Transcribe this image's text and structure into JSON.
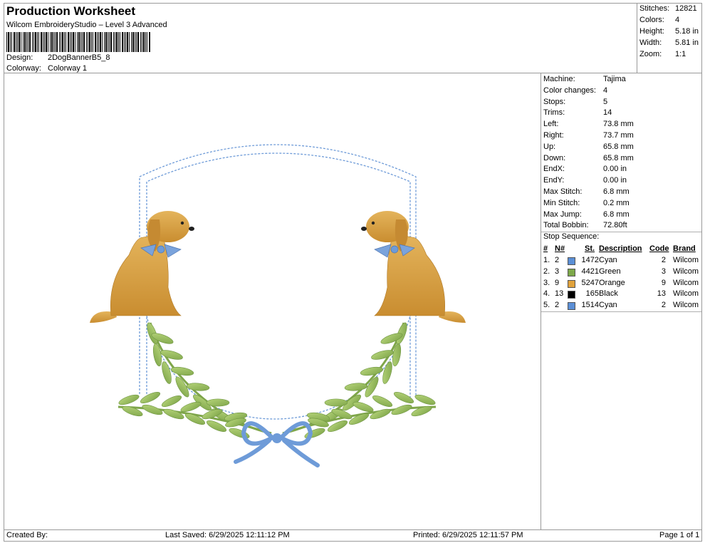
{
  "header": {
    "title": "Production Worksheet",
    "subtitle": "Wilcom EmbroideryStudio – Level 3 Advanced",
    "design_label": "Design:",
    "design_value": "2DogBannerB5_8",
    "colorway_label": "Colorway:",
    "colorway_value": "Colorway 1"
  },
  "stats": [
    {
      "label": "Stitches:",
      "value": "12821"
    },
    {
      "label": "Colors:",
      "value": "4"
    },
    {
      "label": "Height:",
      "value": "5.18 in"
    },
    {
      "label": "Width:",
      "value": "5.81 in"
    },
    {
      "label": "Zoom:",
      "value": "1:1"
    }
  ],
  "specs": [
    {
      "label": "Machine:",
      "value": "Tajima"
    },
    {
      "label": "Color changes:",
      "value": "4"
    },
    {
      "label": "Stops:",
      "value": "5"
    },
    {
      "label": "Trims:",
      "value": "14"
    },
    {
      "label": "Left:",
      "value": "73.8 mm"
    },
    {
      "label": "Right:",
      "value": "73.7 mm"
    },
    {
      "label": "Up:",
      "value": "65.8 mm"
    },
    {
      "label": "Down:",
      "value": "65.8 mm"
    },
    {
      "label": "EndX:",
      "value": "0.00 in"
    },
    {
      "label": "EndY:",
      "value": "0.00 in"
    },
    {
      "label": "Max Stitch:",
      "value": "6.8 mm"
    },
    {
      "label": "Min Stitch:",
      "value": "0.2 mm"
    },
    {
      "label": "Max Jump:",
      "value": "6.8 mm"
    },
    {
      "label": "Total Bobbin:",
      "value": "72.80ft"
    }
  ],
  "stop_sequence": {
    "title": "Stop Sequence:",
    "headers": {
      "num": "#",
      "n": "N#",
      "st": "St.",
      "desc": "Description",
      "code": "Code",
      "brand": "Brand"
    },
    "rows": [
      {
        "num": "1.",
        "n": "2",
        "color": "#5b8fd6",
        "st": "1472",
        "desc": "Cyan",
        "code": "2",
        "brand": "Wilcom"
      },
      {
        "num": "2.",
        "n": "3",
        "color": "#7da84a",
        "st": "4421",
        "desc": "Green",
        "code": "3",
        "brand": "Wilcom"
      },
      {
        "num": "3.",
        "n": "9",
        "color": "#e0a23c",
        "st": "5247",
        "desc": "Orange",
        "code": "9",
        "brand": "Wilcom"
      },
      {
        "num": "4.",
        "n": "13",
        "color": "#000000",
        "st": "165",
        "desc": "Black",
        "code": "13",
        "brand": "Wilcom"
      },
      {
        "num": "5.",
        "n": "2",
        "color": "#5b8fd6",
        "st": "1514",
        "desc": "Cyan",
        "code": "2",
        "brand": "Wilcom"
      }
    ]
  },
  "footer": {
    "created": "Created By:",
    "saved": "Last Saved: 6/29/2025 12:11:12 PM",
    "printed": "Printed: 6/29/2025 12:11:57 PM",
    "page": "Page 1 of 1"
  },
  "design_colors": {
    "cyan": "#6e9bd8",
    "green": "#9bc25c",
    "orange": "#d9a043",
    "black": "#1a1a1a"
  }
}
